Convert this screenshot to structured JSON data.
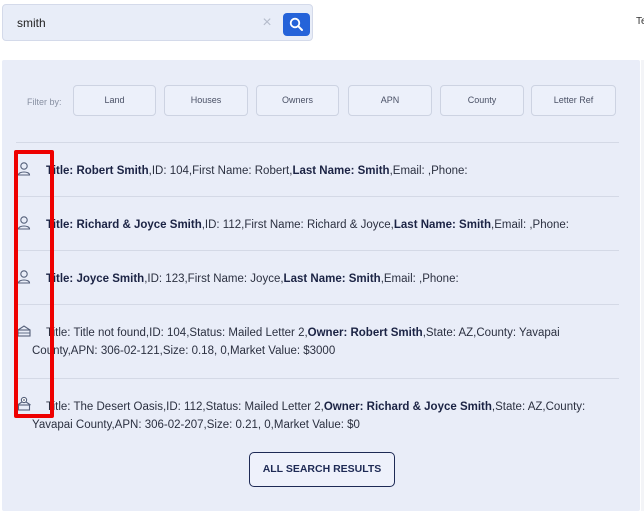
{
  "search": {
    "value": "smith",
    "clear_glyph": "×",
    "button_icon": "search-icon"
  },
  "cut_text": "Te",
  "filters": {
    "label": "Filter by:",
    "buttons": [
      "Land",
      "Houses",
      "Owners",
      "APN",
      "County",
      "Letter Ref"
    ]
  },
  "results": [
    {
      "icon": "person-icon",
      "parts": [
        {
          "b": "Title: Robert Smith"
        },
        {
          "t": ",ID: 104,First Name: Robert,"
        },
        {
          "b": "Last Name: Smith"
        },
        {
          "t": ",Email: ,Phone:"
        }
      ]
    },
    {
      "icon": "person-icon",
      "parts": [
        {
          "b": "Title: Richard & Joyce Smith"
        },
        {
          "t": ",ID: 112,First Name: Richard & Joyce,"
        },
        {
          "b": "Last Name: Smith"
        },
        {
          "t": ",Email: ,Phone:"
        }
      ]
    },
    {
      "icon": "person-icon",
      "parts": [
        {
          "b": "Title: Joyce Smith"
        },
        {
          "t": ",ID: 123,First Name: Joyce,"
        },
        {
          "b": "Last Name: Smith"
        },
        {
          "t": ",Email: ,Phone:"
        }
      ]
    },
    {
      "icon": "land-icon",
      "parts": [
        {
          "t": "Title: Title not found,ID: 104,Status: Mailed Letter 2,"
        },
        {
          "b": "Owner: Robert Smith"
        },
        {
          "t": ",State: AZ,County: Yavapai County,APN: 306-02-121,Size: 0.18, 0,Market Value: $3000"
        }
      ]
    },
    {
      "icon": "house-pin-icon",
      "parts": [
        {
          "t": "Title: The Desert Oasis,ID: 112,Status: Mailed Letter 2,"
        },
        {
          "b": "Owner: Richard & Joyce Smith"
        },
        {
          "t": ",State: AZ,County: Yavapai County,APN: 306-02-207,Size: 0.21, 0,Market Value: $0"
        }
      ]
    }
  ],
  "all_results_label": "ALL SEARCH RESULTS",
  "colors": {
    "accent": "#2563d9",
    "panel": "#e9edf8",
    "highlight": "#ee0000",
    "navy": "#1e2a55"
  }
}
